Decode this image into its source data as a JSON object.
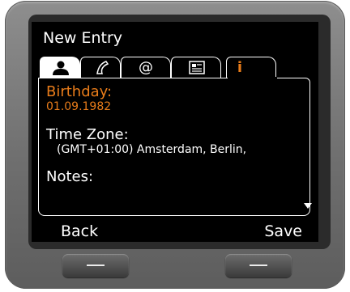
{
  "screen": {
    "title": "New Entry"
  },
  "tabs": [
    {
      "icon": "person-icon",
      "glyph": "",
      "state": "active"
    },
    {
      "icon": "phone-handset-icon",
      "glyph": "✆",
      "state": "normal"
    },
    {
      "icon": "at-sign-icon",
      "glyph": "@",
      "state": "normal"
    },
    {
      "icon": "business-card-icon",
      "glyph": "▤",
      "state": "normal"
    },
    {
      "icon": "info-icon",
      "glyph": "i",
      "state": "selected"
    }
  ],
  "fields": {
    "birthday_label": "Birthday:",
    "birthday_value": "01.09.1982",
    "timezone_label": "Time Zone:",
    "timezone_value": "(GMT+01:00) Amsterdam, Berlin,",
    "notes_label": "Notes:"
  },
  "softkeys": {
    "left": "Back",
    "right": "Save"
  },
  "colors": {
    "accent": "#e87c1a",
    "screen_bg": "#000000",
    "text": "#ffffff"
  }
}
